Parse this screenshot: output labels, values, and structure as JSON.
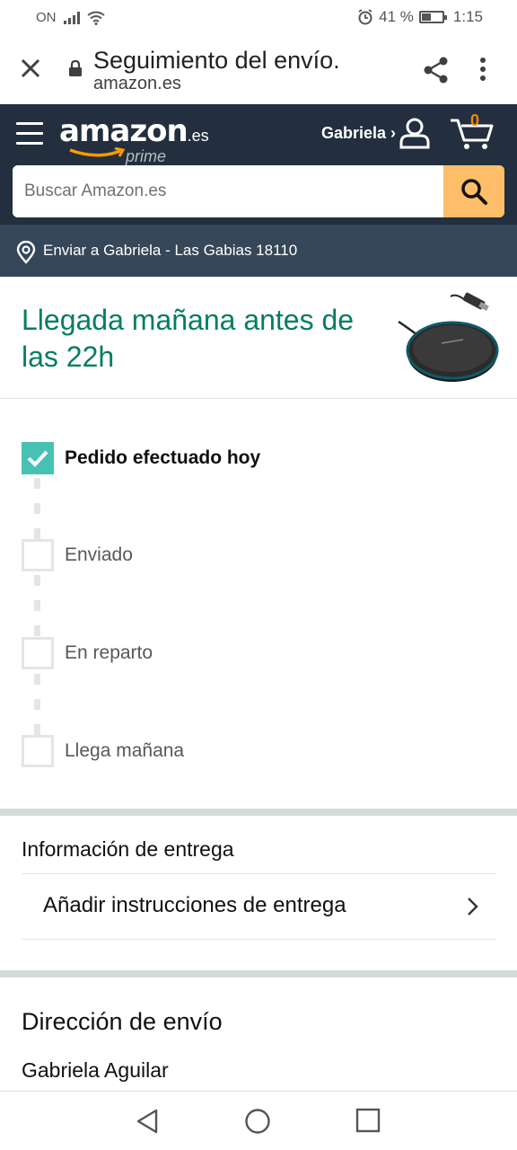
{
  "status_bar": {
    "carrier": "ON",
    "battery": "41 %",
    "time": "1:15"
  },
  "browser": {
    "title": "Seguimiento del envío.",
    "url": "amazon.es"
  },
  "amazon_nav": {
    "logo_text": "amazon",
    "logo_tld": ".es",
    "logo_sub": "prime",
    "account_label": "Gabriela ›",
    "cart_count": "0",
    "search_placeholder": "Buscar Amazon.es"
  },
  "deliver_to": "Enviar a Gabriela - Las Gabias 18110",
  "arrival": {
    "headline": "Llegada mañana antes de las 22h"
  },
  "tracker": {
    "steps": [
      {
        "label": "Pedido efectuado hoy",
        "done": true
      },
      {
        "label": "Enviado",
        "done": false
      },
      {
        "label": "En reparto",
        "done": false
      },
      {
        "label": "Llega mañana",
        "done": false
      }
    ]
  },
  "delivery_info": {
    "heading": "Información de entrega",
    "add_instructions": "Añadir instrucciones de entrega"
  },
  "address": {
    "heading": "Dirección de envío",
    "name": "Gabriela Aguilar"
  },
  "colors": {
    "nav_bg": "#232f3e",
    "deliver_bg": "#37475a",
    "accent_teal": "#067d62",
    "check_teal": "#48c1b5",
    "search_btn": "#febd69",
    "cart_orange": "#f08804"
  }
}
